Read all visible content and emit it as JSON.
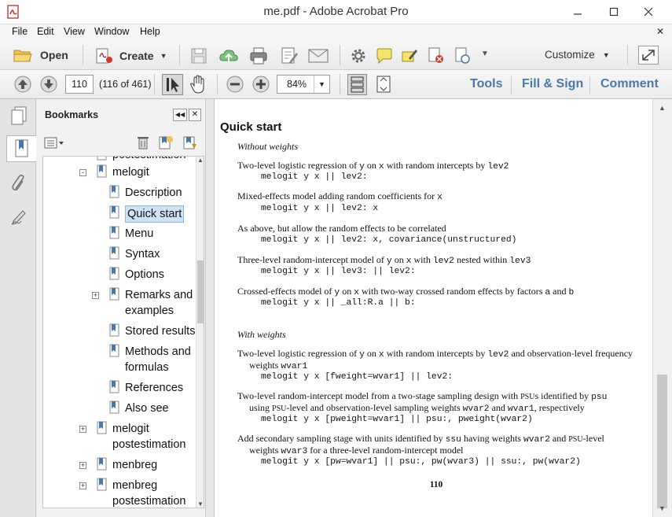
{
  "window": {
    "title": "me.pdf - Adobe Acrobat Pro"
  },
  "menu": [
    "File",
    "Edit",
    "View",
    "Window",
    "Help"
  ],
  "toolbar": {
    "open": "Open",
    "create": "Create",
    "customize": "Customize"
  },
  "nav": {
    "page_value": "110",
    "page_count": "(116 of 461)",
    "zoom": "84%"
  },
  "panels": {
    "tools": "Tools",
    "fill_sign": "Fill & Sign",
    "comment": "Comment"
  },
  "bookmarks": {
    "title": "Bookmarks",
    "items": [
      {
        "label": "postestimation",
        "level": 0,
        "expander": ""
      },
      {
        "label": "melogit",
        "level": 0,
        "expander": "-"
      },
      {
        "label": "Description",
        "level": 1,
        "expander": ""
      },
      {
        "label": "Quick start",
        "level": 1,
        "expander": "",
        "selected": true
      },
      {
        "label": "Menu",
        "level": 1,
        "expander": ""
      },
      {
        "label": "Syntax",
        "level": 1,
        "expander": ""
      },
      {
        "label": "Options",
        "level": 1,
        "expander": ""
      },
      {
        "label": "Remarks and examples",
        "level": 1,
        "expander": "+"
      },
      {
        "label": "Stored results",
        "level": 1,
        "expander": ""
      },
      {
        "label": "Methods and formulas",
        "level": 1,
        "expander": ""
      },
      {
        "label": "References",
        "level": 1,
        "expander": ""
      },
      {
        "label": "Also see",
        "level": 1,
        "expander": ""
      },
      {
        "label": "melogit postestimation",
        "level": 0,
        "expander": "+"
      },
      {
        "label": "menbreg",
        "level": 0,
        "expander": "+"
      },
      {
        "label": "menbreg postestimation",
        "level": 0,
        "expander": "+"
      }
    ]
  },
  "document": {
    "heading": "Quick start",
    "without_weights": "Without weights",
    "with_weights": "With weights",
    "page_number": "110",
    "entries": [
      {
        "desc": "Two-level logistic regression of y on x with random intercepts by lev2",
        "code": "melogit y x || lev2:"
      },
      {
        "desc": "Mixed-effects model adding random coefficients for x",
        "code": "melogit y x || lev2: x"
      },
      {
        "desc": "As above, but allow the random effects to be correlated",
        "code": "melogit y x || lev2: x, covariance(unstructured)"
      },
      {
        "desc": "Three-level random-intercept model of y on x with lev2 nested within lev3",
        "code": "melogit y x || lev3: || lev2:"
      },
      {
        "desc": "Crossed-effects model of y on x with two-way crossed random effects by factors a and b",
        "code": "melogit y x || _all:R.a || b:"
      }
    ],
    "weighted_entries": [
      {
        "desc": "Two-level logistic regression of y on x with random intercepts by lev2 and observation-level frequency",
        "desc2": "weights wvar1",
        "code": "melogit y x [fweight=wvar1] || lev2:"
      },
      {
        "desc": "Two-level random-intercept model from a two-stage sampling design with PSUs identified by psu",
        "desc2": "using PSU-level and observation-level sampling weights wvar2 and wvar1, respectively",
        "code": "melogit y x [pweight=wvar1] || psu:, pweight(wvar2)"
      },
      {
        "desc": "Add secondary sampling stage with units identified by ssu having weights wvar2 and PSU-level",
        "desc2": "weights wvar3 for a three-level random-intercept model",
        "code": "melogit y x [pw=wvar1] || psu:, pw(wvar3) || ssu:, pw(wvar2)"
      }
    ]
  }
}
